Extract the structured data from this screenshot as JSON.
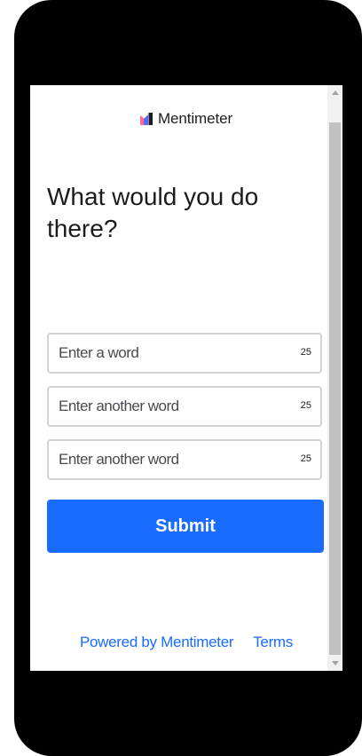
{
  "brand": {
    "name": "Mentimeter",
    "logo_icon": "mentimeter-logo-icon",
    "colors": {
      "left": "#ff6b8a",
      "middle": "#5769ff",
      "right": "#1b1b22"
    }
  },
  "question": {
    "title": "What would you do there?"
  },
  "inputs": [
    {
      "placeholder": "Enter a word",
      "value": "",
      "counter": "25"
    },
    {
      "placeholder": "Enter another word",
      "value": "",
      "counter": "25"
    },
    {
      "placeholder": "Enter another word",
      "value": "",
      "counter": "25"
    }
  ],
  "submit": {
    "label": "Submit",
    "color": "#196cff"
  },
  "footer": {
    "powered_by": "Powered by Mentimeter",
    "terms": "Terms",
    "link_color": "#196cff"
  },
  "scrollbar": {
    "up_icon": "scroll-up-arrow-icon",
    "down_icon": "scroll-down-arrow-icon"
  }
}
